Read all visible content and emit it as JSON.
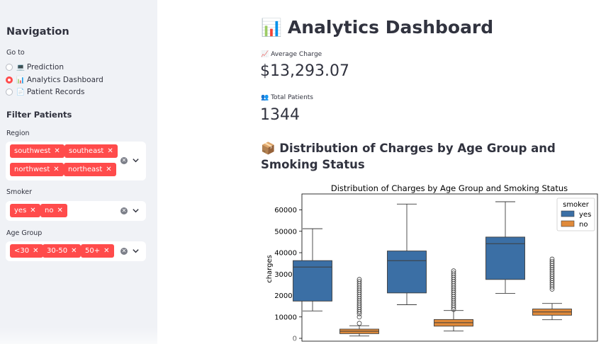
{
  "sidebar": {
    "title": "Navigation",
    "goto_label": "Go to",
    "nav": [
      {
        "icon": "💻",
        "label": "Prediction",
        "selected": false
      },
      {
        "icon": "📊",
        "label": "Analytics Dashboard",
        "selected": true
      },
      {
        "icon": "📄",
        "label": "Patient Records",
        "selected": false
      }
    ],
    "filter_title": "Filter Patients",
    "region": {
      "label": "Region",
      "tags": [
        "southwest",
        "southeast",
        "northwest",
        "northeast"
      ]
    },
    "smoker": {
      "label": "Smoker",
      "tags": [
        "yes",
        "no"
      ]
    },
    "age_group": {
      "label": "Age Group",
      "tags": [
        "<30",
        "30-50",
        "50+"
      ]
    }
  },
  "main": {
    "title_icon": "📊",
    "title": "Analytics Dashboard",
    "metrics": [
      {
        "icon": "📈",
        "label": "Average Charge",
        "value": "$13,293.07"
      },
      {
        "icon": "👥",
        "label": "Total Patients",
        "value": "1344"
      }
    ],
    "section_icon": "📦",
    "section_title": "Distribution of Charges by Age Group and Smoking Status"
  },
  "colors": {
    "accent": "#ff4b4b",
    "yes": "#3b6fa5",
    "no": "#e08a3a",
    "sidebar_bg": "#f0f2f6"
  },
  "chart_data": {
    "type": "box",
    "title": "Distribution of Charges by Age Group and Smoking Status",
    "ylabel": "charges",
    "xlabel": "",
    "ylim": [
      0,
      65000
    ],
    "yticks": [
      0,
      10000,
      20000,
      30000,
      40000,
      50000,
      60000
    ],
    "legend": {
      "title": "smoker",
      "position": "top-right",
      "entries": [
        "yes",
        "no"
      ]
    },
    "groups": [
      {
        "yes": {
          "whislo": 12800,
          "q1": 17400,
          "median": 33300,
          "q3": 36300,
          "whishi": 51200
        },
        "no": {
          "whislo": 1100,
          "q1": 2200,
          "median": 3300,
          "q3": 4300,
          "whishi": 5900,
          "fliers": [
            7000,
            10000,
            11500,
            12500,
            13500,
            14500,
            15500,
            16500,
            17500,
            18500,
            19500,
            20500,
            21500,
            22500,
            23500,
            24500,
            25500,
            26500,
            27500
          ]
        }
      },
      {
        "yes": {
          "whislo": 15700,
          "q1": 21200,
          "median": 36300,
          "q3": 40800,
          "whishi": 62700
        },
        "no": {
          "whislo": 3400,
          "q1": 5700,
          "median": 7300,
          "q3": 8800,
          "whishi": 13000,
          "fliers": [
            13500,
            14500,
            15500,
            16500,
            17500,
            18500,
            19500,
            20500,
            21500,
            22500,
            23500,
            24500,
            25500,
            26500,
            27500,
            28500,
            29500,
            30500,
            31500
          ]
        }
      },
      {
        "yes": {
          "whislo": 21000,
          "q1": 27500,
          "median": 44200,
          "q3": 47300,
          "whishi": 63800
        },
        "no": {
          "whislo": 8700,
          "q1": 10800,
          "median": 12300,
          "q3": 13700,
          "whishi": 16300,
          "fliers": [
            23000,
            24000,
            25000,
            26000,
            27000,
            28000,
            29000,
            30000,
            31000,
            32000,
            33000,
            34000,
            35000,
            36000,
            37000
          ]
        }
      }
    ]
  }
}
